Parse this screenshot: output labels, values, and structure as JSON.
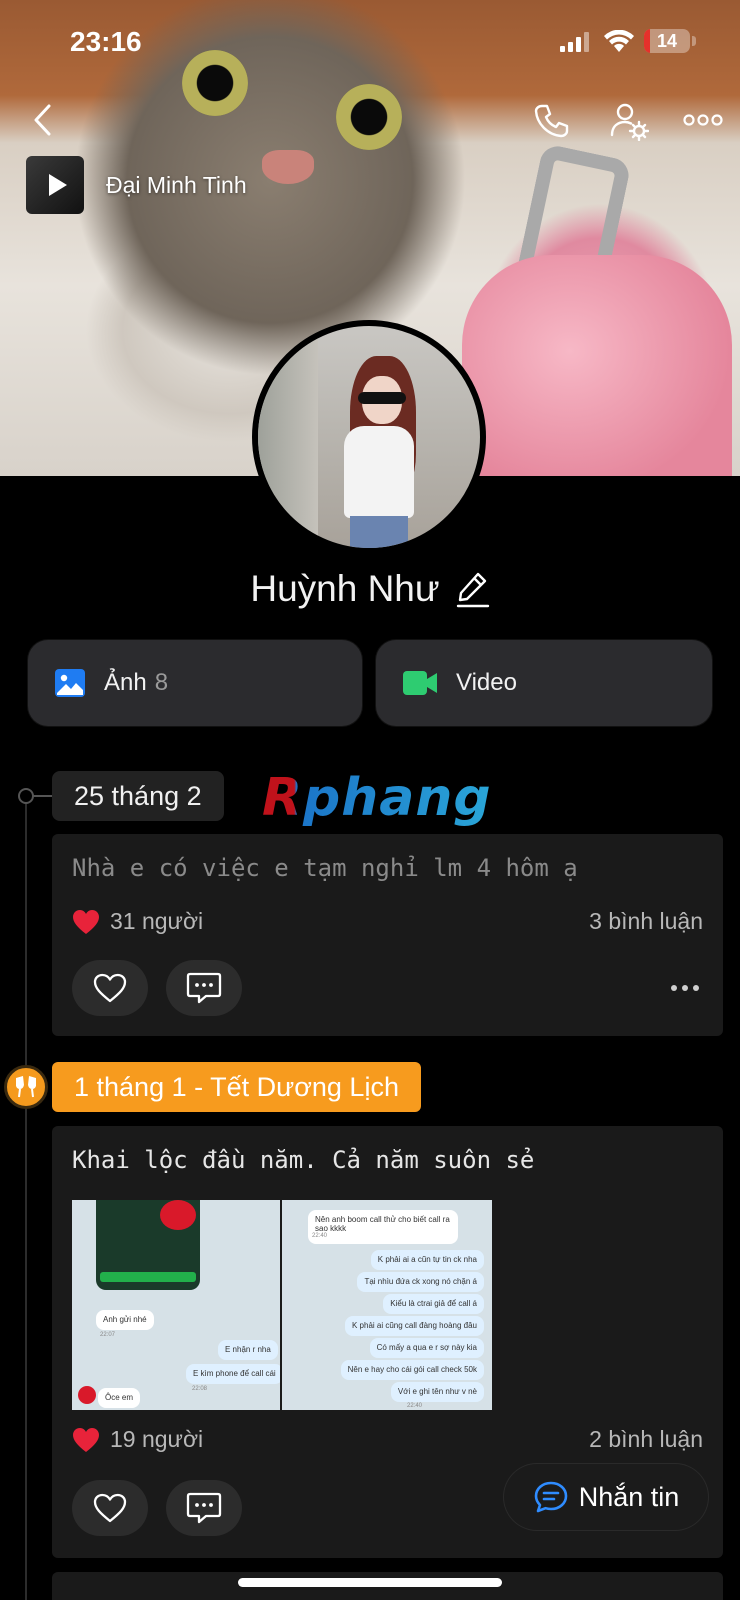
{
  "status_bar": {
    "time": "23:16",
    "battery": "14",
    "battery_level": 0.14,
    "battery_color": "#e5312b"
  },
  "header": {
    "back_icon": "chevron-left-icon",
    "call_icon": "phone-icon",
    "settings_icon": "user-gear-icon",
    "more_icon": "more-horizontal-icon"
  },
  "music": {
    "title": "Đại Minh Tinh",
    "icon": "play-icon"
  },
  "profile": {
    "name": "Huỳnh Như",
    "edit_icon": "pencil-icon"
  },
  "media": {
    "photos_label": "Ảnh",
    "photos_count": "8",
    "videos_label": "Video",
    "photos_color": "#1f7cf2",
    "video_color": "#2ecc71"
  },
  "watermark": "Rphang",
  "posts": [
    {
      "date": "25 tháng 2",
      "text": "Nhà e có việc e tạm nghỉ lm 4 hôm ạ",
      "likes": "31 người",
      "comments": "3 bình luận"
    },
    {
      "event": "1 tháng 1 - Tết Dương Lịch",
      "event_icon": "cheers-icon",
      "event_color": "#f79b1e",
      "text": "Khai lộc đầu năm. Cả năm suôn sẻ",
      "likes": "19 người",
      "comments": "2 bình luận",
      "photo_left": {
        "bubbles": [
          "Anh gửi nhé",
          "E nhận r nha",
          "E kìm phone để call cái",
          "Ôce em"
        ],
        "times": [
          "22:07",
          "22:08"
        ]
      },
      "photo_right": {
        "bubbles": [
          "Nên anh boom call thử cho biết call ra sao kkkk",
          "K phải ai a cũn tự tin ck nha",
          "Tại nhìu đứa ck xong nó chặn á",
          "Kiểu là ctrai giả để call á",
          "K phải ai cũng call đàng hoàng đâu",
          "Có mấy a qua e r sợ này kia",
          "Nên e hay cho cái gói call check 50k",
          "Với e ghi tên như v nè"
        ],
        "times": [
          "22:40",
          "22:40"
        ]
      }
    }
  ],
  "chat_button": {
    "label": "Nhắn tin",
    "icon": "chat-bubble-icon",
    "color": "#2f8cff"
  }
}
